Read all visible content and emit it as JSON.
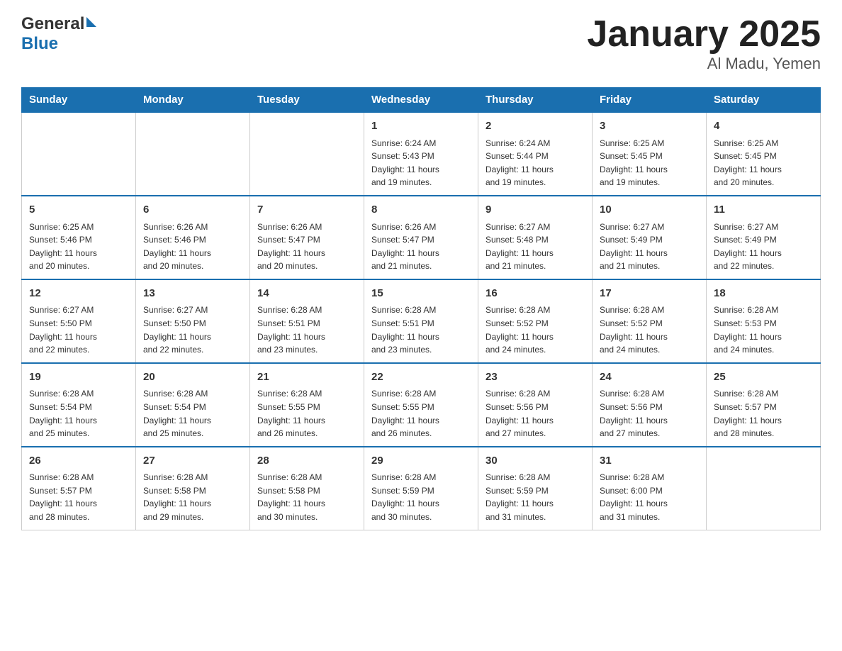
{
  "header": {
    "logo_general": "General",
    "logo_blue": "Blue",
    "title": "January 2025",
    "subtitle": "Al Madu, Yemen"
  },
  "weekdays": [
    "Sunday",
    "Monday",
    "Tuesday",
    "Wednesday",
    "Thursday",
    "Friday",
    "Saturday"
  ],
  "weeks": [
    [
      {
        "day": "",
        "info": ""
      },
      {
        "day": "",
        "info": ""
      },
      {
        "day": "",
        "info": ""
      },
      {
        "day": "1",
        "info": "Sunrise: 6:24 AM\nSunset: 5:43 PM\nDaylight: 11 hours\nand 19 minutes."
      },
      {
        "day": "2",
        "info": "Sunrise: 6:24 AM\nSunset: 5:44 PM\nDaylight: 11 hours\nand 19 minutes."
      },
      {
        "day": "3",
        "info": "Sunrise: 6:25 AM\nSunset: 5:45 PM\nDaylight: 11 hours\nand 19 minutes."
      },
      {
        "day": "4",
        "info": "Sunrise: 6:25 AM\nSunset: 5:45 PM\nDaylight: 11 hours\nand 20 minutes."
      }
    ],
    [
      {
        "day": "5",
        "info": "Sunrise: 6:25 AM\nSunset: 5:46 PM\nDaylight: 11 hours\nand 20 minutes."
      },
      {
        "day": "6",
        "info": "Sunrise: 6:26 AM\nSunset: 5:46 PM\nDaylight: 11 hours\nand 20 minutes."
      },
      {
        "day": "7",
        "info": "Sunrise: 6:26 AM\nSunset: 5:47 PM\nDaylight: 11 hours\nand 20 minutes."
      },
      {
        "day": "8",
        "info": "Sunrise: 6:26 AM\nSunset: 5:47 PM\nDaylight: 11 hours\nand 21 minutes."
      },
      {
        "day": "9",
        "info": "Sunrise: 6:27 AM\nSunset: 5:48 PM\nDaylight: 11 hours\nand 21 minutes."
      },
      {
        "day": "10",
        "info": "Sunrise: 6:27 AM\nSunset: 5:49 PM\nDaylight: 11 hours\nand 21 minutes."
      },
      {
        "day": "11",
        "info": "Sunrise: 6:27 AM\nSunset: 5:49 PM\nDaylight: 11 hours\nand 22 minutes."
      }
    ],
    [
      {
        "day": "12",
        "info": "Sunrise: 6:27 AM\nSunset: 5:50 PM\nDaylight: 11 hours\nand 22 minutes."
      },
      {
        "day": "13",
        "info": "Sunrise: 6:27 AM\nSunset: 5:50 PM\nDaylight: 11 hours\nand 22 minutes."
      },
      {
        "day": "14",
        "info": "Sunrise: 6:28 AM\nSunset: 5:51 PM\nDaylight: 11 hours\nand 23 minutes."
      },
      {
        "day": "15",
        "info": "Sunrise: 6:28 AM\nSunset: 5:51 PM\nDaylight: 11 hours\nand 23 minutes."
      },
      {
        "day": "16",
        "info": "Sunrise: 6:28 AM\nSunset: 5:52 PM\nDaylight: 11 hours\nand 24 minutes."
      },
      {
        "day": "17",
        "info": "Sunrise: 6:28 AM\nSunset: 5:52 PM\nDaylight: 11 hours\nand 24 minutes."
      },
      {
        "day": "18",
        "info": "Sunrise: 6:28 AM\nSunset: 5:53 PM\nDaylight: 11 hours\nand 24 minutes."
      }
    ],
    [
      {
        "day": "19",
        "info": "Sunrise: 6:28 AM\nSunset: 5:54 PM\nDaylight: 11 hours\nand 25 minutes."
      },
      {
        "day": "20",
        "info": "Sunrise: 6:28 AM\nSunset: 5:54 PM\nDaylight: 11 hours\nand 25 minutes."
      },
      {
        "day": "21",
        "info": "Sunrise: 6:28 AM\nSunset: 5:55 PM\nDaylight: 11 hours\nand 26 minutes."
      },
      {
        "day": "22",
        "info": "Sunrise: 6:28 AM\nSunset: 5:55 PM\nDaylight: 11 hours\nand 26 minutes."
      },
      {
        "day": "23",
        "info": "Sunrise: 6:28 AM\nSunset: 5:56 PM\nDaylight: 11 hours\nand 27 minutes."
      },
      {
        "day": "24",
        "info": "Sunrise: 6:28 AM\nSunset: 5:56 PM\nDaylight: 11 hours\nand 27 minutes."
      },
      {
        "day": "25",
        "info": "Sunrise: 6:28 AM\nSunset: 5:57 PM\nDaylight: 11 hours\nand 28 minutes."
      }
    ],
    [
      {
        "day": "26",
        "info": "Sunrise: 6:28 AM\nSunset: 5:57 PM\nDaylight: 11 hours\nand 28 minutes."
      },
      {
        "day": "27",
        "info": "Sunrise: 6:28 AM\nSunset: 5:58 PM\nDaylight: 11 hours\nand 29 minutes."
      },
      {
        "day": "28",
        "info": "Sunrise: 6:28 AM\nSunset: 5:58 PM\nDaylight: 11 hours\nand 30 minutes."
      },
      {
        "day": "29",
        "info": "Sunrise: 6:28 AM\nSunset: 5:59 PM\nDaylight: 11 hours\nand 30 minutes."
      },
      {
        "day": "30",
        "info": "Sunrise: 6:28 AM\nSunset: 5:59 PM\nDaylight: 11 hours\nand 31 minutes."
      },
      {
        "day": "31",
        "info": "Sunrise: 6:28 AM\nSunset: 6:00 PM\nDaylight: 11 hours\nand 31 minutes."
      },
      {
        "day": "",
        "info": ""
      }
    ]
  ]
}
